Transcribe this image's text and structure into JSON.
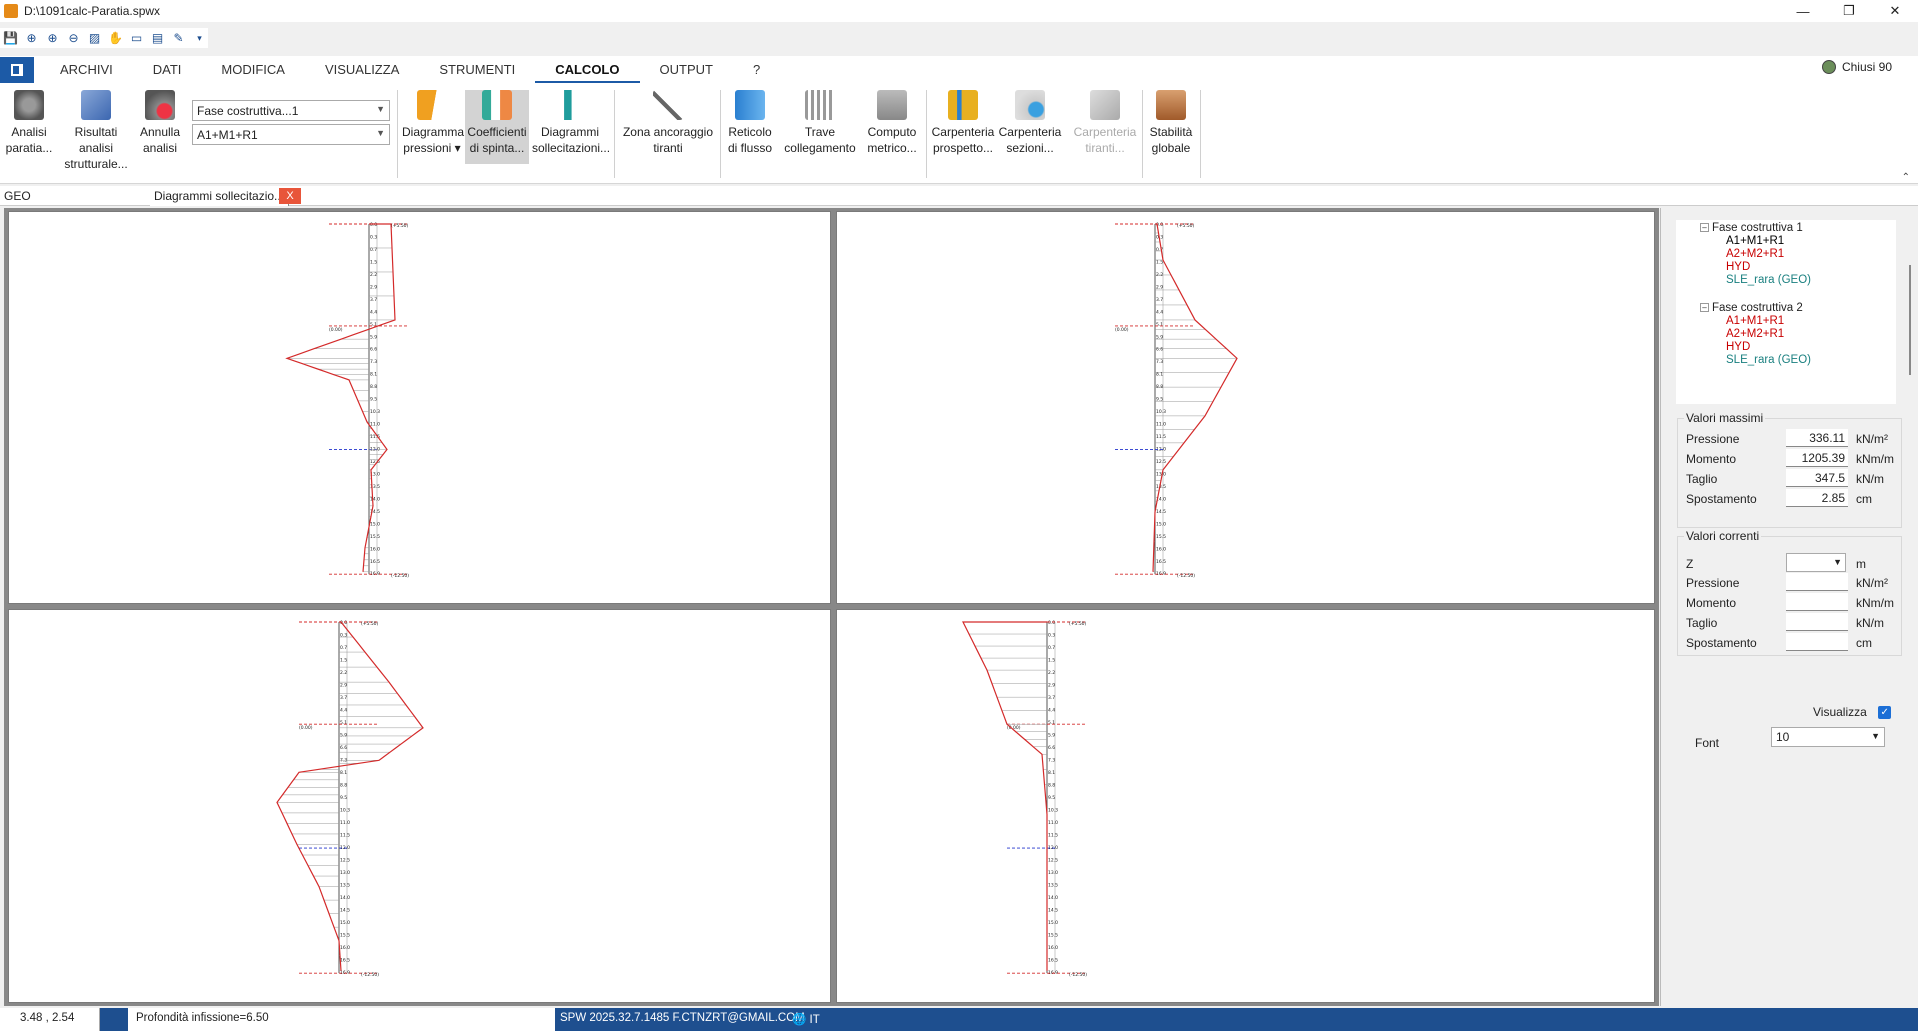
{
  "window": {
    "title": "D:\\1091calc-Paratia.spwx"
  },
  "menu": {
    "items": [
      "ARCHIVI",
      "DATI",
      "MODIFICA",
      "VISUALIZZA",
      "STRUMENTI",
      "CALCOLO",
      "OUTPUT",
      "?"
    ],
    "active": "CALCOLO"
  },
  "user": {
    "label": "Chiusi 90"
  },
  "ribbon": {
    "analisi_paratia": [
      "Analisi",
      "paratia..."
    ],
    "risultati_analisi": [
      "Risultati analisi",
      "strutturale..."
    ],
    "annulla_analisi": [
      "Annulla",
      "analisi"
    ],
    "combo_fase": "Fase costruttiva...1",
    "combo_comb": "A1+M1+R1",
    "diagramma_pressioni": [
      "Diagramma",
      "pressioni ▾"
    ],
    "coefficienti_spinta": [
      "Coefficienti",
      "di spinta..."
    ],
    "diagrammi_sollecitazioni": [
      "Diagrammi",
      "sollecitazioni..."
    ],
    "zona_ancoraggio": [
      "Zona ancoraggio",
      "tiranti"
    ],
    "reticolo_flusso": [
      "Reticolo",
      "di flusso"
    ],
    "trave_collegamento": [
      "Trave",
      "collegamento"
    ],
    "computo_metrico": [
      "Computo",
      "metrico..."
    ],
    "carpenteria_prospetto": [
      "Carpenteria",
      "prospetto..."
    ],
    "carpenteria_sezioni": [
      "Carpenteria",
      "sezioni..."
    ],
    "carpenteria_tiranti": [
      "Carpenteria",
      "tiranti..."
    ],
    "stabilita_globale": [
      "Stabilità",
      "globale"
    ]
  },
  "tabs": {
    "geo": "GEO",
    "diagrammi": "Diagrammi sollecitazio...",
    "close": "X"
  },
  "tree": {
    "fase1": "Fase costruttiva 1",
    "fase1_items": [
      {
        "label": "A1+M1+R1",
        "color": "#000000"
      },
      {
        "label": "A2+M2+R1",
        "color": "#c80000"
      },
      {
        "label": "HYD",
        "color": "#c80000"
      },
      {
        "label": "SLE_rara (GEO)",
        "color": "#1a8080"
      }
    ],
    "fase2": "Fase costruttiva 2",
    "fase2_items": [
      {
        "label": "A1+M1+R1",
        "color": "#c80000"
      },
      {
        "label": "A2+M2+R1",
        "color": "#c80000"
      },
      {
        "label": "HYD",
        "color": "#c80000"
      },
      {
        "label": "SLE_rara (GEO)",
        "color": "#1a8080"
      }
    ]
  },
  "valori_massimi": {
    "title": "Valori massimi",
    "rows": [
      {
        "label": "Pressione",
        "value": "336.11",
        "unit": "kN/m²"
      },
      {
        "label": "Momento",
        "value": "1205.39",
        "unit": "kNm/m"
      },
      {
        "label": "Taglio",
        "value": "347.5",
        "unit": "kN/m"
      },
      {
        "label": "Spostamento",
        "value": "2.85",
        "unit": "cm"
      }
    ]
  },
  "valori_correnti": {
    "title": "Valori correnti",
    "z_label": "Z",
    "z_unit": "m",
    "rows": [
      {
        "label": "Pressione",
        "value": "",
        "unit": "kN/m²"
      },
      {
        "label": "Momento",
        "value": "",
        "unit": "kNm/m"
      },
      {
        "label": "Taglio",
        "value": "",
        "unit": "kN/m"
      },
      {
        "label": "Spostamento",
        "value": "",
        "unit": "cm"
      }
    ]
  },
  "visualizza": {
    "label": "Visualizza",
    "checked": true
  },
  "font": {
    "label": "Font",
    "value": "10"
  },
  "status": {
    "coords": "3.48 , 2.54",
    "infissione": "Profondità infissione=6.50",
    "version": "SPW 2025.32.7.1485 F.CTNZRT@GMAIL.COM",
    "lang": "IT"
  },
  "plots": {
    "depth_labels": [
      "0.0",
      "0.3",
      "0.7",
      "1.5",
      "2.2",
      "2.9",
      "3.7",
      "4.4",
      "5.1",
      "5.9",
      "6.6",
      "7.3",
      "8.1",
      "8.8",
      "9.5",
      "10.3",
      "11.0",
      "11.5",
      "12.0",
      "12.5",
      "13.0",
      "13.5",
      "14.0",
      "14.5",
      "15.0",
      "15.5",
      "16.0",
      "16.5",
      "16.9"
    ],
    "top_label": "(+5.50)",
    "mid_label": "(0.00)",
    "bot_label": "(-12.50)",
    "line_color": "#d42a2a",
    "anchor_color": "#2233cc"
  }
}
